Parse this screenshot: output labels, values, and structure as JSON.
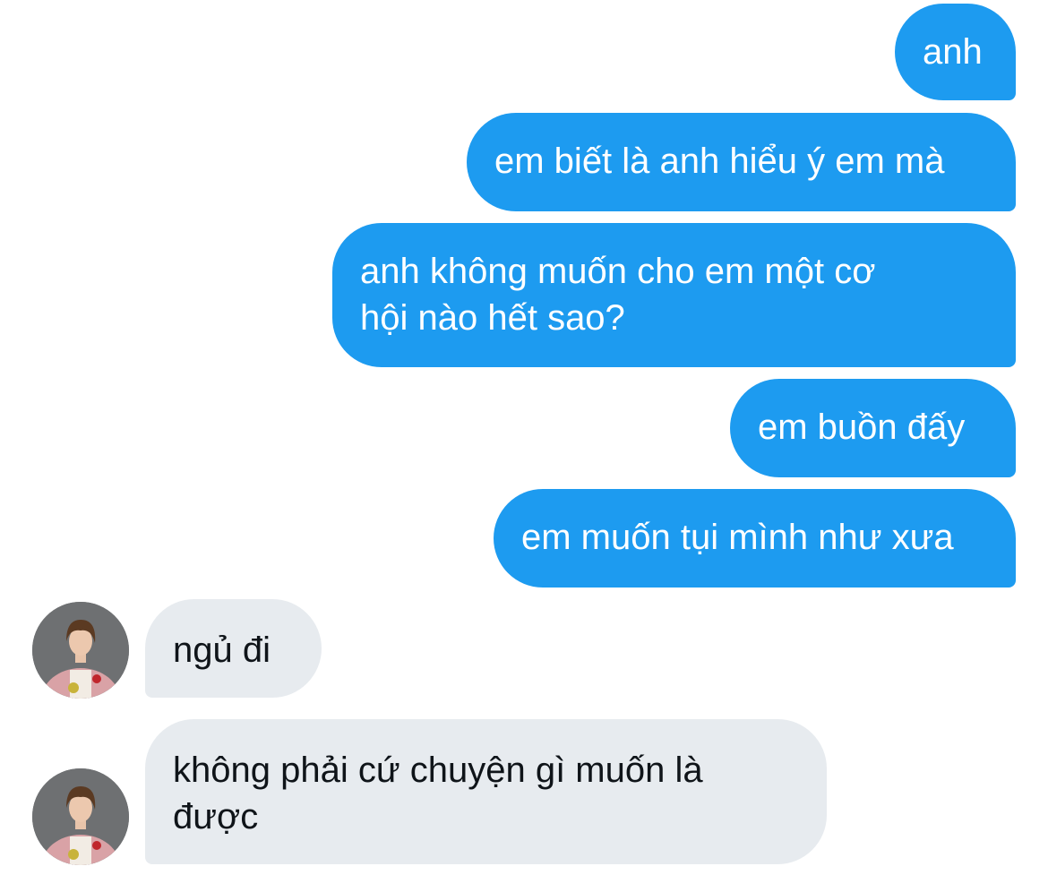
{
  "conversation": {
    "sent": [
      {
        "text": "anh"
      },
      {
        "text": "em biết là anh hiểu ý em mà"
      },
      {
        "text": "anh không muốn cho em một cơ",
        "text2": "hội nào hết sao?"
      },
      {
        "text": "em buồn đấy"
      },
      {
        "text": "em muốn tụi mình như xưa"
      }
    ],
    "received": [
      {
        "text": "ngủ đi"
      },
      {
        "text": "không phải cứ chuyện gì muốn là",
        "text2": "được"
      }
    ]
  },
  "avatar_icon": "user-avatar-photo",
  "colors": {
    "sent_bubble": "#1d9bf0",
    "received_bubble": "#e7ebef",
    "sent_text": "#ffffff",
    "received_text": "#0f1419"
  }
}
